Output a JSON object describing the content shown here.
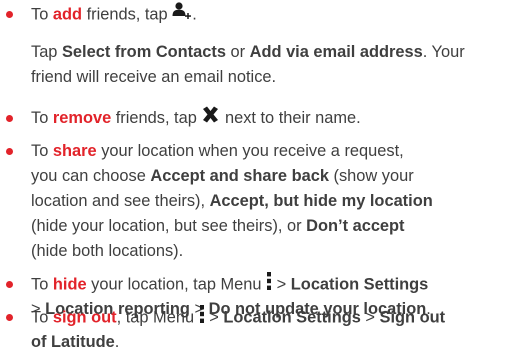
{
  "colors": {
    "accent": "#e2232a",
    "text": "#3f3f3f"
  },
  "add_item": {
    "pre": "To",
    "action": "add",
    "post": "friends, tap",
    "icon": "add-person-icon",
    "end": "."
  },
  "add_note": {
    "line1_pre": "Tap",
    "select_contacts": "Select from Contacts",
    "or": "or",
    "add_email": "Add via email address",
    "line1_end": ". Your",
    "line2": "friend will receive an email notice."
  },
  "remove_item": {
    "pre": "To",
    "action": "remove",
    "post": "friends, tap",
    "icon": "remove-x-icon",
    "end": "next to their name."
  },
  "share_item": {
    "line1_pre": "To",
    "action": "share",
    "line1_post": "your location when you receive a request,",
    "line2_pre": "you can choose",
    "accept_share": "Accept and share back",
    "line2_post": "(show your",
    "line3_pre": "location and see theirs),",
    "accept_hide": "Accept, but hide my location",
    "line4_pre": "(hide your location, but see theirs), or",
    "dont_accept": "Don’t accept",
    "line5": "(hide both locations)."
  },
  "hide_item": {
    "pre": "To",
    "action": "hide",
    "post": "your location, tap Menu",
    "icon": "menu-icon",
    "gt1": ">",
    "location_settings": "Location Settings",
    "gt2": ">",
    "location_reporting": "Location reporting",
    "gt3": ">",
    "do_not_update": "Do not update your location",
    "end": "."
  },
  "signout_item": {
    "pre": "To",
    "action": "sign out",
    "post": ", tap Menu",
    "icon": "menu-icon",
    "gt1": ">",
    "location_settings": "Location Settings",
    "gt2": ">",
    "sign_out_1": "Sign out",
    "sign_out_2": "of Latitude",
    "end": "."
  }
}
